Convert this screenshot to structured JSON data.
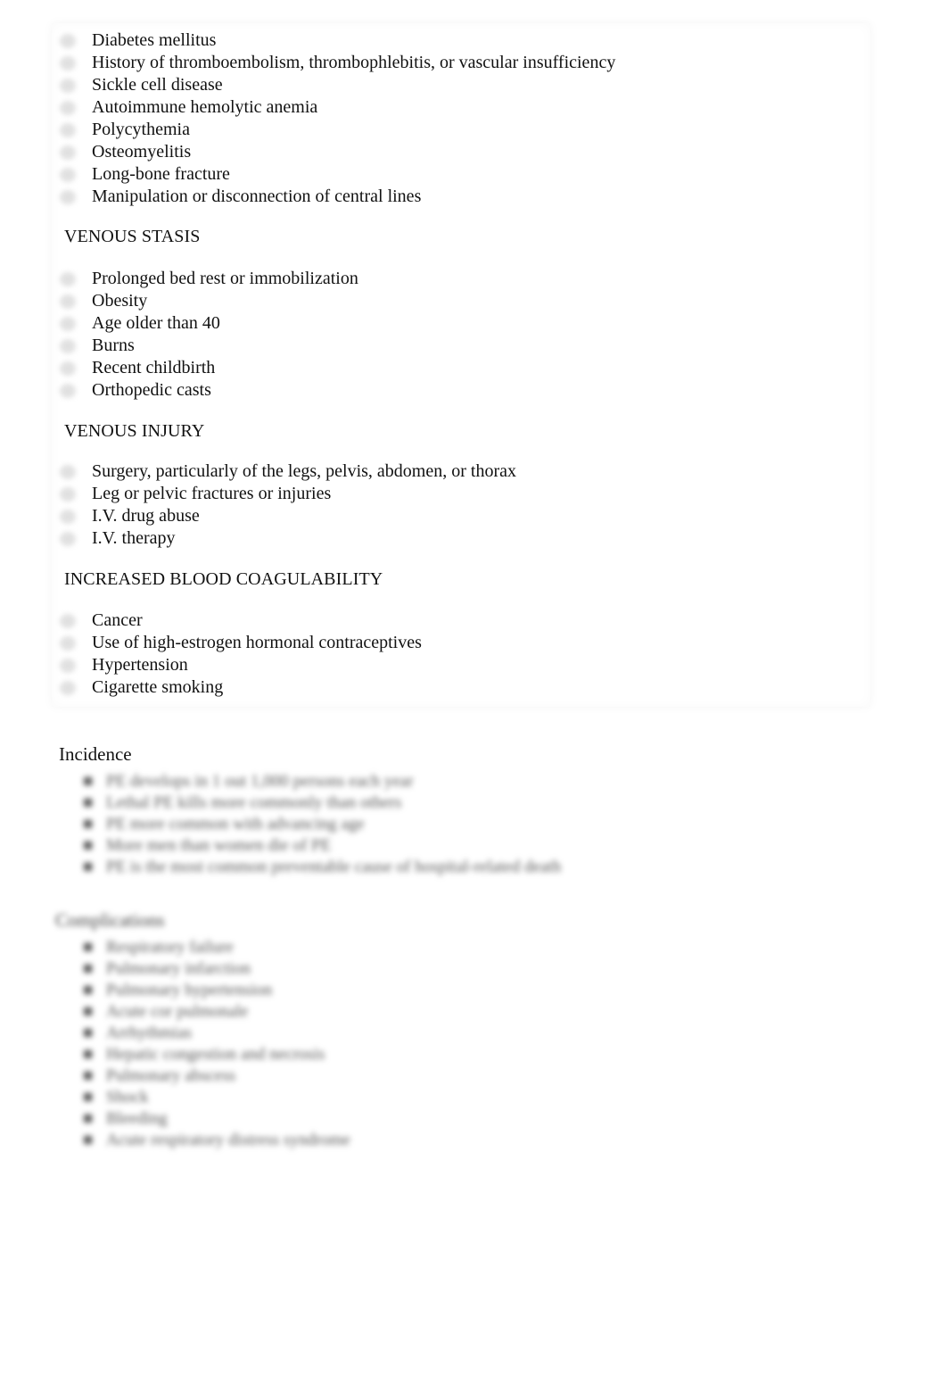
{
  "risk_factors": {
    "top_items": [
      "Diabetes mellitus",
      "History of thromboembolism, thrombophlebitis, or vascular insufficiency",
      "Sickle cell disease",
      "Autoimmune hemolytic anemia",
      "Polycythemia",
      "Osteomyelitis",
      "Long-bone fracture",
      "Manipulation or disconnection of central lines"
    ],
    "venous_stasis": {
      "heading": "VENOUS STASIS",
      "items": [
        "Prolonged bed rest or immobilization",
        "Obesity",
        "Age older than 40",
        "Burns",
        "Recent childbirth",
        "Orthopedic casts"
      ]
    },
    "venous_injury": {
      "heading": "VENOUS INJURY",
      "items": [
        "Surgery, particularly of the legs, pelvis, abdomen, or thorax",
        "Leg or pelvic fractures or injuries",
        "I.V. drug abuse",
        "I.V. therapy"
      ]
    },
    "increased_coagulability": {
      "heading": "INCREASED BLOOD COAGULABILITY",
      "items": [
        "Cancer",
        "Use of high-estrogen hormonal contraceptives",
        "Hypertension",
        "Cigarette smoking"
      ]
    }
  },
  "incidence": {
    "heading": "Incidence",
    "blurred_items": [
      {
        "marker": "■",
        "text": "PE develops in 1 out 1,000 persons each year"
      },
      {
        "marker": "■",
        "text": "Lethal PE kills more commonly than others"
      },
      {
        "marker": "■",
        "text": "PE more common with advancing age"
      },
      {
        "marker": "■",
        "text": "More men than women die of PE"
      },
      {
        "marker": "■",
        "text": "PE is the most common preventable cause of hospital-related death"
      }
    ]
  },
  "complications": {
    "heading": "Complications",
    "blurred_items": [
      {
        "marker": "■",
        "text": "Respiratory failure"
      },
      {
        "marker": "■",
        "text": "Pulmonary infarction"
      },
      {
        "marker": "■",
        "text": "Pulmonary hypertension"
      },
      {
        "marker": "■",
        "text": "Acute cor pulmonale"
      },
      {
        "marker": "■",
        "text": "Arrhythmias"
      },
      {
        "marker": "■",
        "text": "Hepatic congestion and necrosis"
      },
      {
        "marker": "■",
        "text": "Pulmonary abscess"
      },
      {
        "marker": "■",
        "text": "Shock"
      },
      {
        "marker": "■",
        "text": "Bleeding"
      },
      {
        "marker": "■",
        "text": "Acute respiratory distress syndrome"
      }
    ]
  }
}
